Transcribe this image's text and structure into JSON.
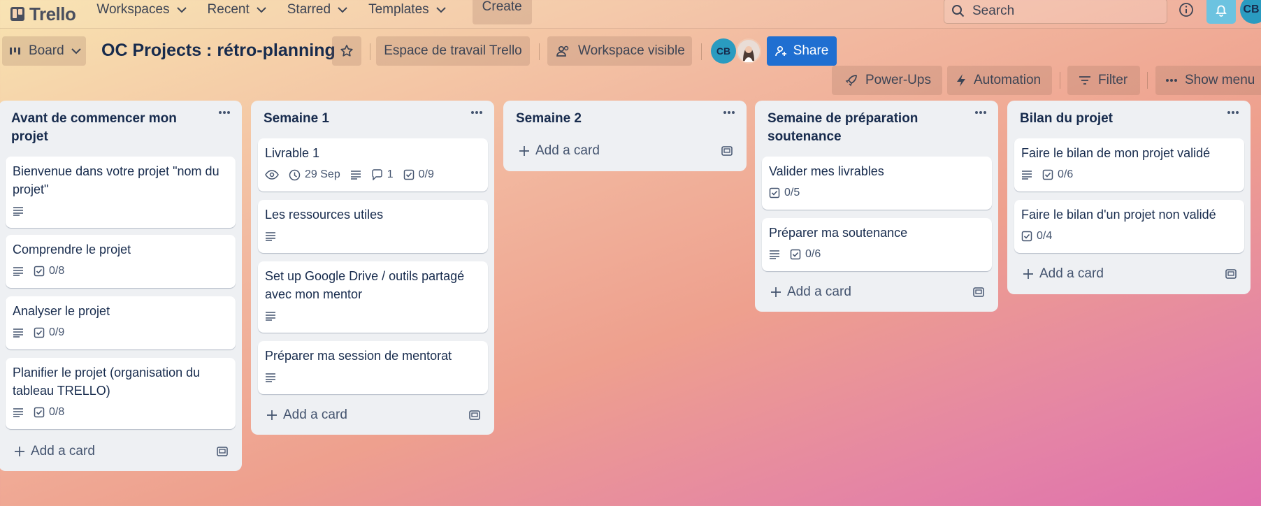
{
  "topnav": {
    "brand": "Trello",
    "menus": [
      "Workspaces",
      "Recent",
      "Starred",
      "Templates"
    ],
    "create_label": "Create",
    "search_placeholder": "Search",
    "user_initials": "CB"
  },
  "board_header": {
    "view_label": "Board",
    "title": "OC Projects : rétro-planning",
    "workspace_label": "Espace de travail Trello",
    "visibility_label": "Workspace visible",
    "member_initials": "CB",
    "share_label": "Share",
    "powerups_label": "Power-Ups",
    "automation_label": "Automation",
    "filter_label": "Filter",
    "menu_label": "Show menu"
  },
  "add_card_label": "Add a card",
  "lists": [
    {
      "title": "Avant de commencer mon projet",
      "cards": [
        {
          "title": "Bienvenue dans votre projet \"nom du projet\"",
          "description": true
        },
        {
          "title": "Comprendre le projet",
          "description": true,
          "checklist": "0/8"
        },
        {
          "title": "Analyser le projet",
          "description": true,
          "checklist": "0/9"
        },
        {
          "title": "Planifier le projet (organisation du tableau TRELLO)",
          "description": true,
          "checklist": "0/8"
        }
      ]
    },
    {
      "title": "Semaine 1",
      "cards": [
        {
          "title": "Livrable 1",
          "watching": true,
          "due": "29 Sep",
          "description": true,
          "comments": "1",
          "checklist": "0/9"
        },
        {
          "title": "Les ressources utiles",
          "description": true
        },
        {
          "title": "Set up Google Drive / outils partagé avec mon mentor",
          "description": true
        },
        {
          "title": "Préparer ma session de mentorat",
          "description": true
        }
      ]
    },
    {
      "title": "Semaine 2",
      "cards": []
    },
    {
      "title": "Semaine de préparation soutenance",
      "cards": [
        {
          "title": "Valider mes livrables",
          "checklist": "0/5"
        },
        {
          "title": "Préparer ma soutenance",
          "description": true,
          "checklist": "0/6"
        }
      ]
    },
    {
      "title": "Bilan du projet",
      "cards": [
        {
          "title": "Faire le bilan de mon projet validé",
          "description": true,
          "checklist": "0/6"
        },
        {
          "title": "Faire le bilan d'un projet non validé",
          "checklist": "0/4"
        }
      ]
    }
  ]
}
